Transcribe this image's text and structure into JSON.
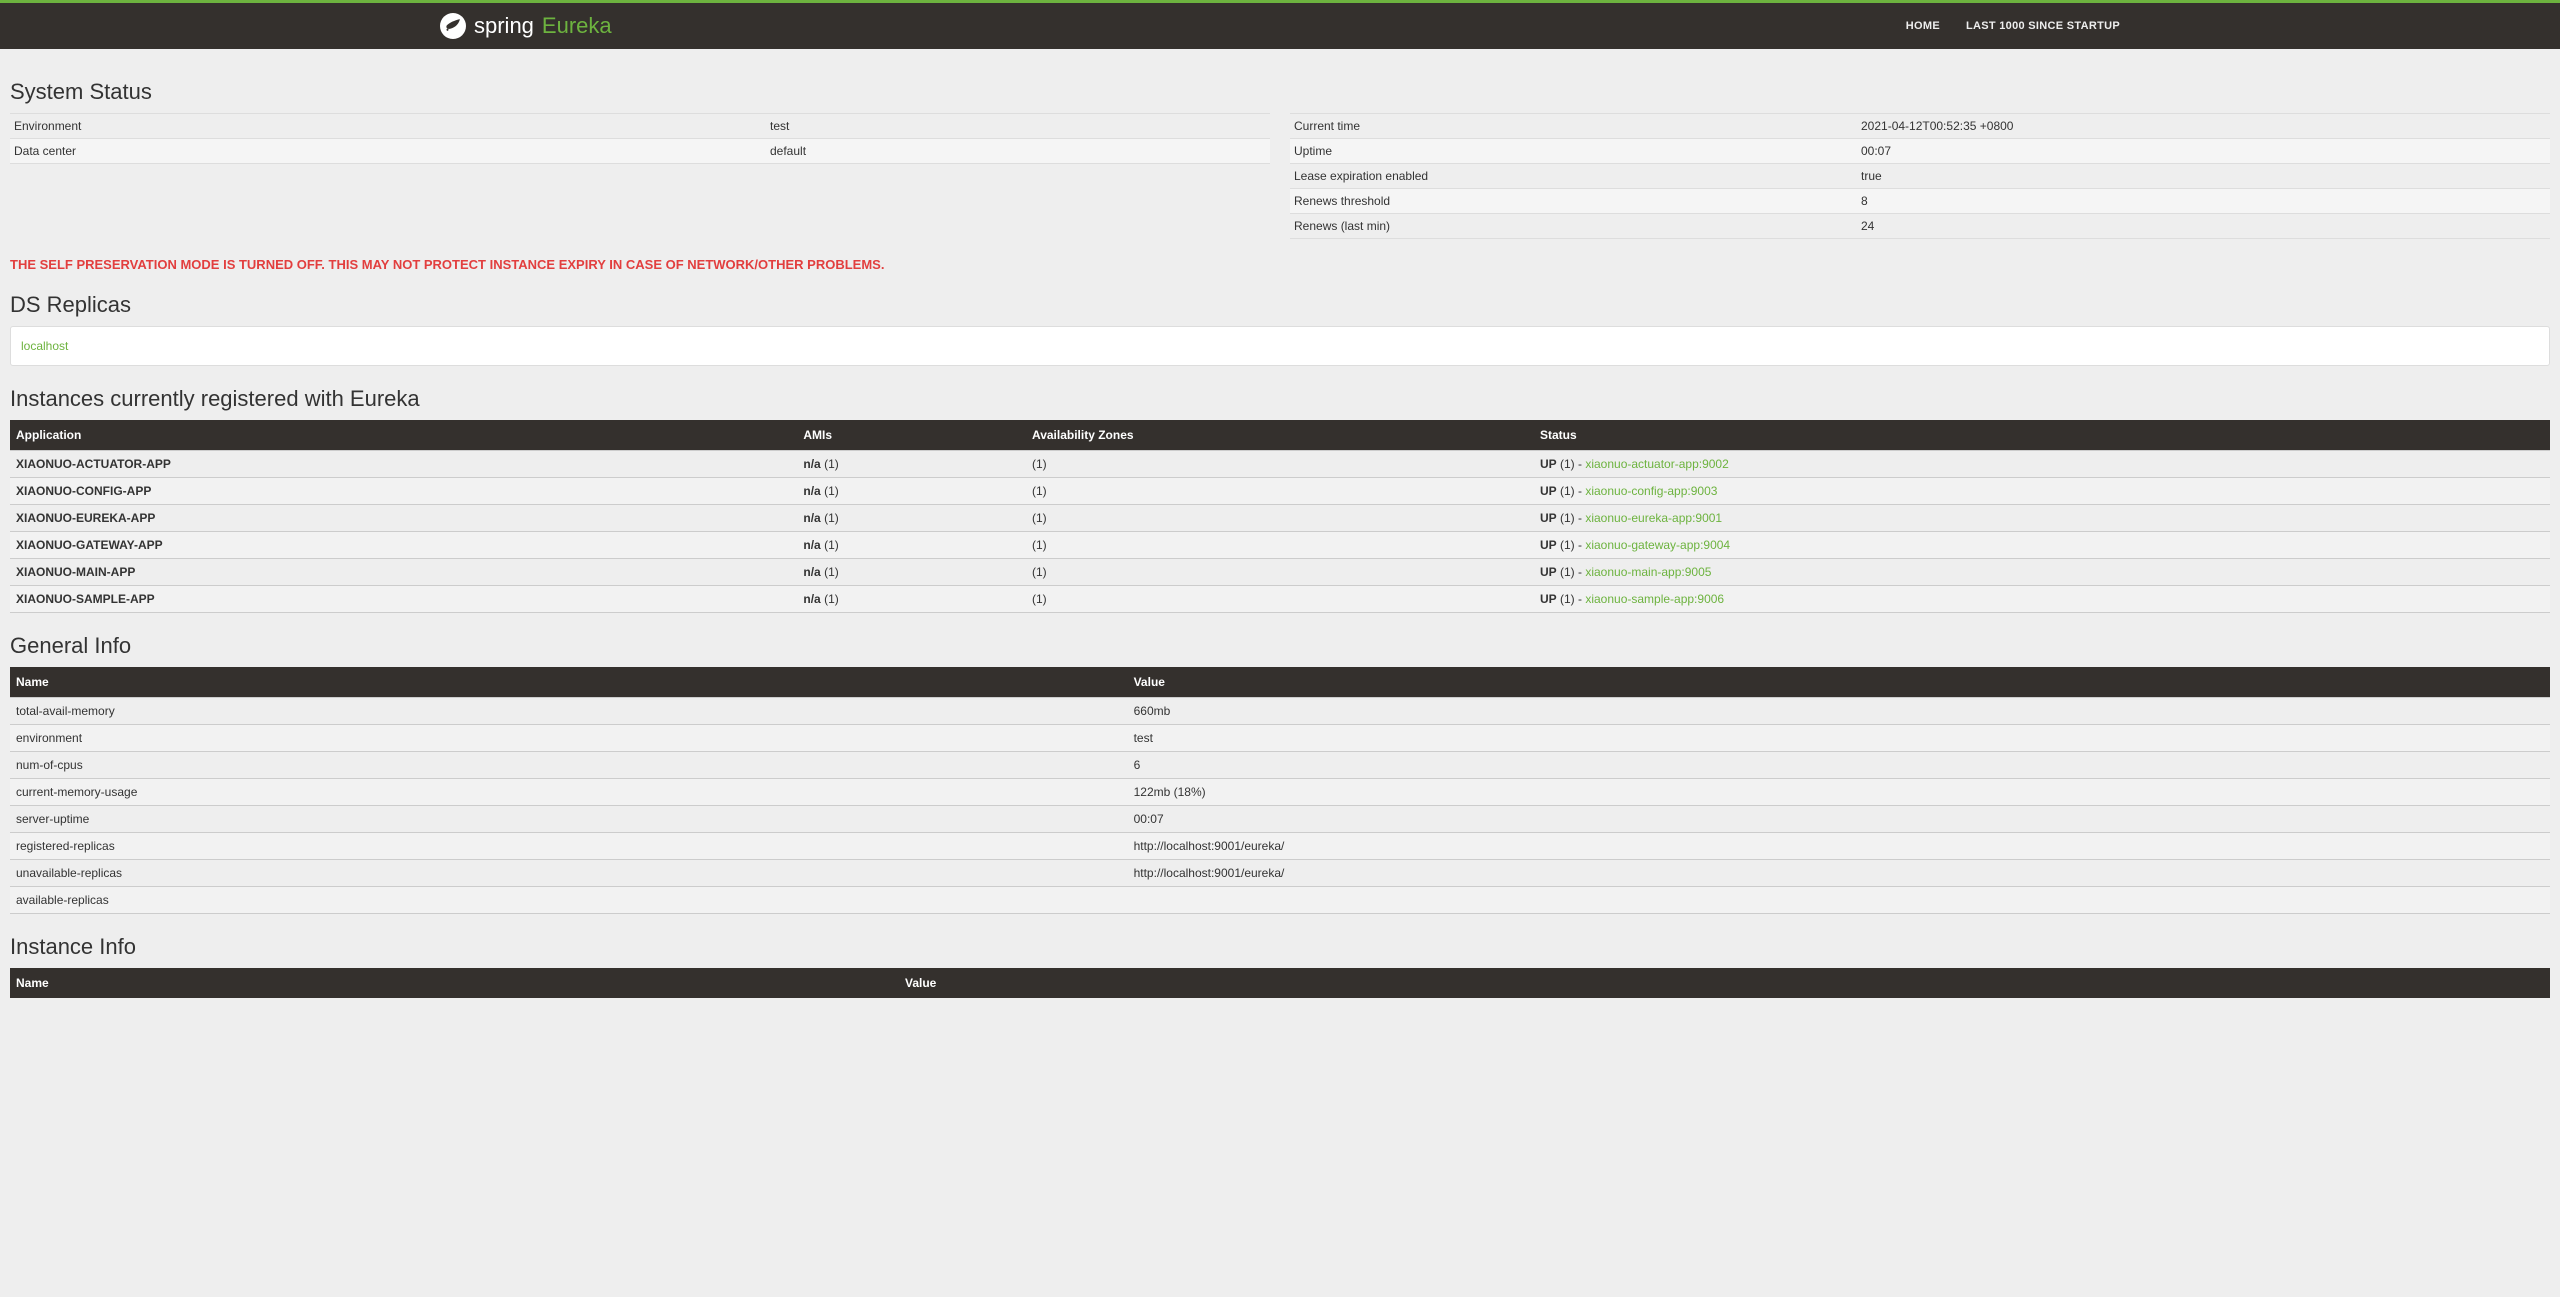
{
  "brand": {
    "spring": "spring",
    "eureka": "Eureka"
  },
  "nav": {
    "home": "HOME",
    "last1000": "LAST 1000 SINCE STARTUP"
  },
  "sections": {
    "system_status": "System Status",
    "ds_replicas": "DS Replicas",
    "instances": "Instances currently registered with Eureka",
    "general_info": "General Info",
    "instance_info": "Instance Info"
  },
  "system_status_left": [
    {
      "k": "Environment",
      "v": "test"
    },
    {
      "k": "Data center",
      "v": "default"
    }
  ],
  "system_status_right": [
    {
      "k": "Current time",
      "v": "2021-04-12T00:52:35 +0800"
    },
    {
      "k": "Uptime",
      "v": "00:07"
    },
    {
      "k": "Lease expiration enabled",
      "v": "true"
    },
    {
      "k": "Renews threshold",
      "v": "8"
    },
    {
      "k": "Renews (last min)",
      "v": "24"
    }
  ],
  "warning": "THE SELF PRESERVATION MODE IS TURNED OFF. THIS MAY NOT PROTECT INSTANCE EXPIRY IN CASE OF NETWORK/OTHER PROBLEMS.",
  "ds_replicas": [
    "localhost"
  ],
  "instances_headers": {
    "app": "Application",
    "amis": "AMIs",
    "az": "Availability Zones",
    "status": "Status"
  },
  "instances": [
    {
      "app": "XIAONUO-ACTUATOR-APP",
      "amis_label": "n/a",
      "amis_count": "(1)",
      "az": "(1)",
      "status": "UP",
      "status_count": "(1) - ",
      "link": "xiaonuo-actuator-app:9002"
    },
    {
      "app": "XIAONUO-CONFIG-APP",
      "amis_label": "n/a",
      "amis_count": "(1)",
      "az": "(1)",
      "status": "UP",
      "status_count": "(1) - ",
      "link": "xiaonuo-config-app:9003"
    },
    {
      "app": "XIAONUO-EUREKA-APP",
      "amis_label": "n/a",
      "amis_count": "(1)",
      "az": "(1)",
      "status": "UP",
      "status_count": "(1) - ",
      "link": "xiaonuo-eureka-app:9001"
    },
    {
      "app": "XIAONUO-GATEWAY-APP",
      "amis_label": "n/a",
      "amis_count": "(1)",
      "az": "(1)",
      "status": "UP",
      "status_count": "(1) - ",
      "link": "xiaonuo-gateway-app:9004"
    },
    {
      "app": "XIAONUO-MAIN-APP",
      "amis_label": "n/a",
      "amis_count": "(1)",
      "az": "(1)",
      "status": "UP",
      "status_count": "(1) - ",
      "link": "xiaonuo-main-app:9005"
    },
    {
      "app": "XIAONUO-SAMPLE-APP",
      "amis_label": "n/a",
      "amis_count": "(1)",
      "az": "(1)",
      "status": "UP",
      "status_count": "(1) - ",
      "link": "xiaonuo-sample-app:9006"
    }
  ],
  "general_info_headers": {
    "name": "Name",
    "value": "Value"
  },
  "general_info": [
    {
      "name": "total-avail-memory",
      "value": "660mb"
    },
    {
      "name": "environment",
      "value": "test"
    },
    {
      "name": "num-of-cpus",
      "value": "6"
    },
    {
      "name": "current-memory-usage",
      "value": "122mb (18%)"
    },
    {
      "name": "server-uptime",
      "value": "00:07"
    },
    {
      "name": "registered-replicas",
      "value": "http://localhost:9001/eureka/"
    },
    {
      "name": "unavailable-replicas",
      "value": "http://localhost:9001/eureka/"
    },
    {
      "name": "available-replicas",
      "value": ""
    }
  ],
  "instance_info_headers": {
    "name": "Name",
    "value": "Value"
  }
}
